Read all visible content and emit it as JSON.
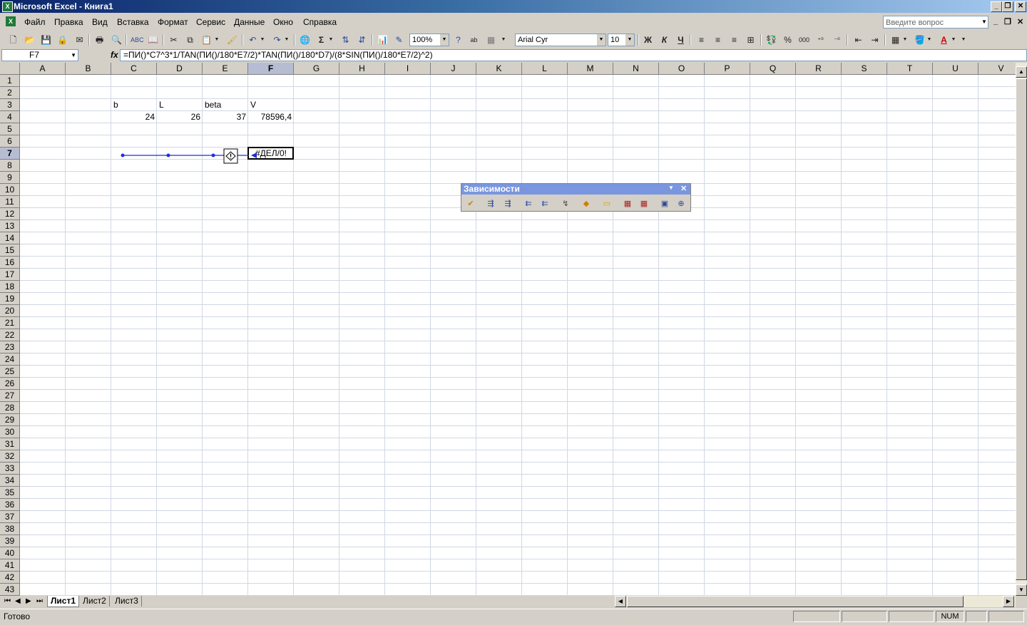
{
  "window": {
    "title": "Microsoft Excel - Книга1"
  },
  "menu": {
    "items": [
      "Файл",
      "Правка",
      "Вид",
      "Вставка",
      "Формат",
      "Сервис",
      "Данные",
      "Окно",
      "Справка"
    ],
    "ask_placeholder": "Введите вопрос"
  },
  "toolbar": {
    "zoom": "100%",
    "font_name": "Arial Cyr",
    "font_size": "10",
    "bold_label": "Ж",
    "italic_label": "К",
    "underline_label": "Ч",
    "percent_label": "%",
    "thousands_label": "000",
    "sum_label": "Σ",
    "abc_label": "ab"
  },
  "formula_bar": {
    "name_box": "F7",
    "fx_label": "fx",
    "formula": "=ПИ()*C7^3*1/TAN(ПИ()/180*E7/2)*TAN(ПИ()/180*D7)/(8*SIN(ПИ()/180*E7/2)^2)"
  },
  "columns": [
    "A",
    "B",
    "C",
    "D",
    "E",
    "F",
    "G",
    "H",
    "I",
    "J",
    "K",
    "L",
    "M",
    "N",
    "O",
    "P",
    "Q",
    "R",
    "S",
    "T",
    "U",
    "V"
  ],
  "row_count": 43,
  "cells": {
    "C3": "b",
    "D3": "L",
    "E3": "beta",
    "F3": "V",
    "C4": "24",
    "D4": "26",
    "E4": "37",
    "F4": "78596,4",
    "F7": "#ДЕЛ/0!"
  },
  "active_cell": {
    "col": "F",
    "row": 7
  },
  "dependencies_toolbar": {
    "title": "Зависимости"
  },
  "sheets": [
    "Лист1",
    "Лист2",
    "Лист3"
  ],
  "active_sheet": "Лист1",
  "status": {
    "text": "Готово",
    "num": "NUM"
  }
}
